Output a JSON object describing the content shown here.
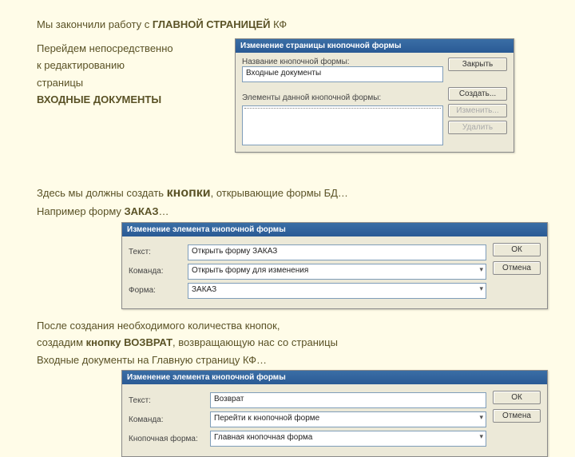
{
  "heading": {
    "pre": "Мы закончили работу с ",
    "strong": "ГЛАВНОЙ СТРАНИЦЕЙ",
    "post": " КФ"
  },
  "intro1": {
    "line1": "Перейдем непосредственно",
    "line2": "к редактированию",
    "line3": "страницы",
    "bold": "ВХОДНЫЕ ДОКУМЕНТЫ"
  },
  "panel1": {
    "title": "Изменение страницы кнопочной формы",
    "name_label": "Название кнопочной формы:",
    "name_value": "Входные документы",
    "items_label": "Элементы данной кнопочной формы:",
    "btn_close": "Закрыть",
    "btn_new": "Создать...",
    "btn_edit": "Изменить...",
    "btn_del": "Удалить"
  },
  "intro2": {
    "pre": "Здесь мы должны создать ",
    "big": "кнопки",
    "mid": ", открывающие формы БД…",
    "line2a": "Например форму ",
    "line2b": "ЗАКАЗ",
    "line2c": "…"
  },
  "panel2": {
    "title": "Изменение элемента кнопочной формы",
    "text_label": "Текст:",
    "text_value": "Открыть форму ЗАКАЗ",
    "cmd_label": "Команда:",
    "cmd_value": "Открыть форму для изменения",
    "form_label": "Форма:",
    "form_value": "ЗАКАЗ",
    "ok": "ОК",
    "cancel": "Отмена"
  },
  "intro3": {
    "l1": "После создания необходимого количества кнопок,",
    "l2a": "создадим ",
    "l2b": "кнопку ВОЗВРАТ",
    "l2c": ", возвращающую нас со страницы",
    "l3": "Входные документы на Главную страницу КФ…"
  },
  "panel3": {
    "title": "Изменение элемента кнопочной формы",
    "text_label": "Текст:",
    "text_value": "Возврат",
    "cmd_label": "Команда:",
    "cmd_value": "Перейти к кнопочной форме",
    "form_label": "Кнопочная форма:",
    "form_value": "Главная кнопочная форма",
    "ok": "ОК",
    "cancel": "Отмена"
  }
}
